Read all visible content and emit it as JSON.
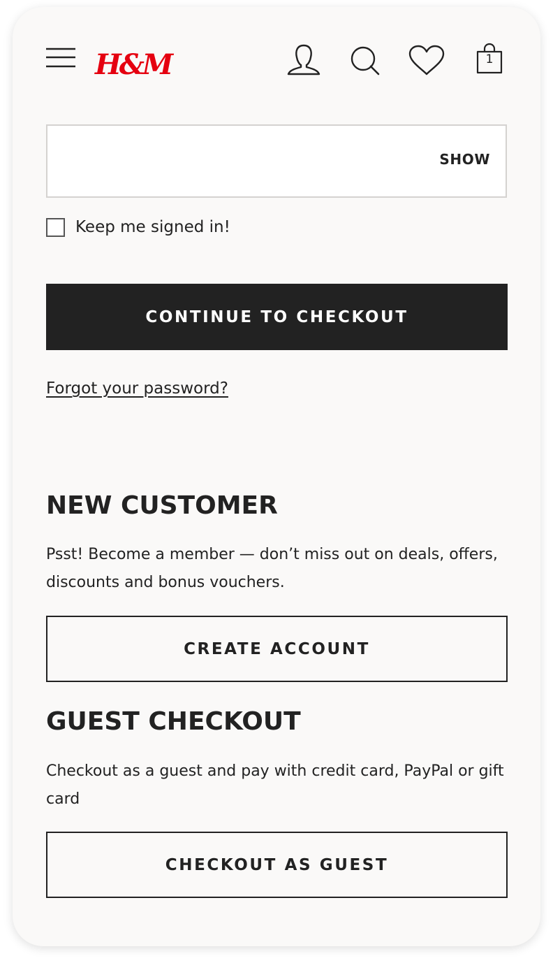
{
  "header": {
    "menu_icon": "hamburger-menu-icon",
    "logo_text": "H&M",
    "account_icon": "user-icon",
    "search_icon": "search-icon",
    "favorites_icon": "heart-icon",
    "bag_icon": "shopping-bag-icon",
    "bag_count": "1",
    "brand_color": "#e50010"
  },
  "login": {
    "password_value": "",
    "show_label": "SHOW",
    "keep_signed_in_label": "Keep me signed in!",
    "keep_signed_in_checked": false,
    "continue_label": "CONTINUE TO CHECKOUT",
    "forgot_password_label": "Forgot your password?"
  },
  "new_customer": {
    "heading": "NEW CUSTOMER",
    "text": "Psst! Become a member — don’t miss out on deals, offers, discounts and bonus vouchers.",
    "button_label": "CREATE ACCOUNT"
  },
  "guest_checkout": {
    "heading": "GUEST CHECKOUT",
    "text": "Checkout as a guest and pay with credit card, PayPal or gift card",
    "button_label": "CHECKOUT AS GUEST"
  },
  "colors": {
    "primary_button": "#222222",
    "background": "#faf9f8",
    "text": "#222222"
  }
}
